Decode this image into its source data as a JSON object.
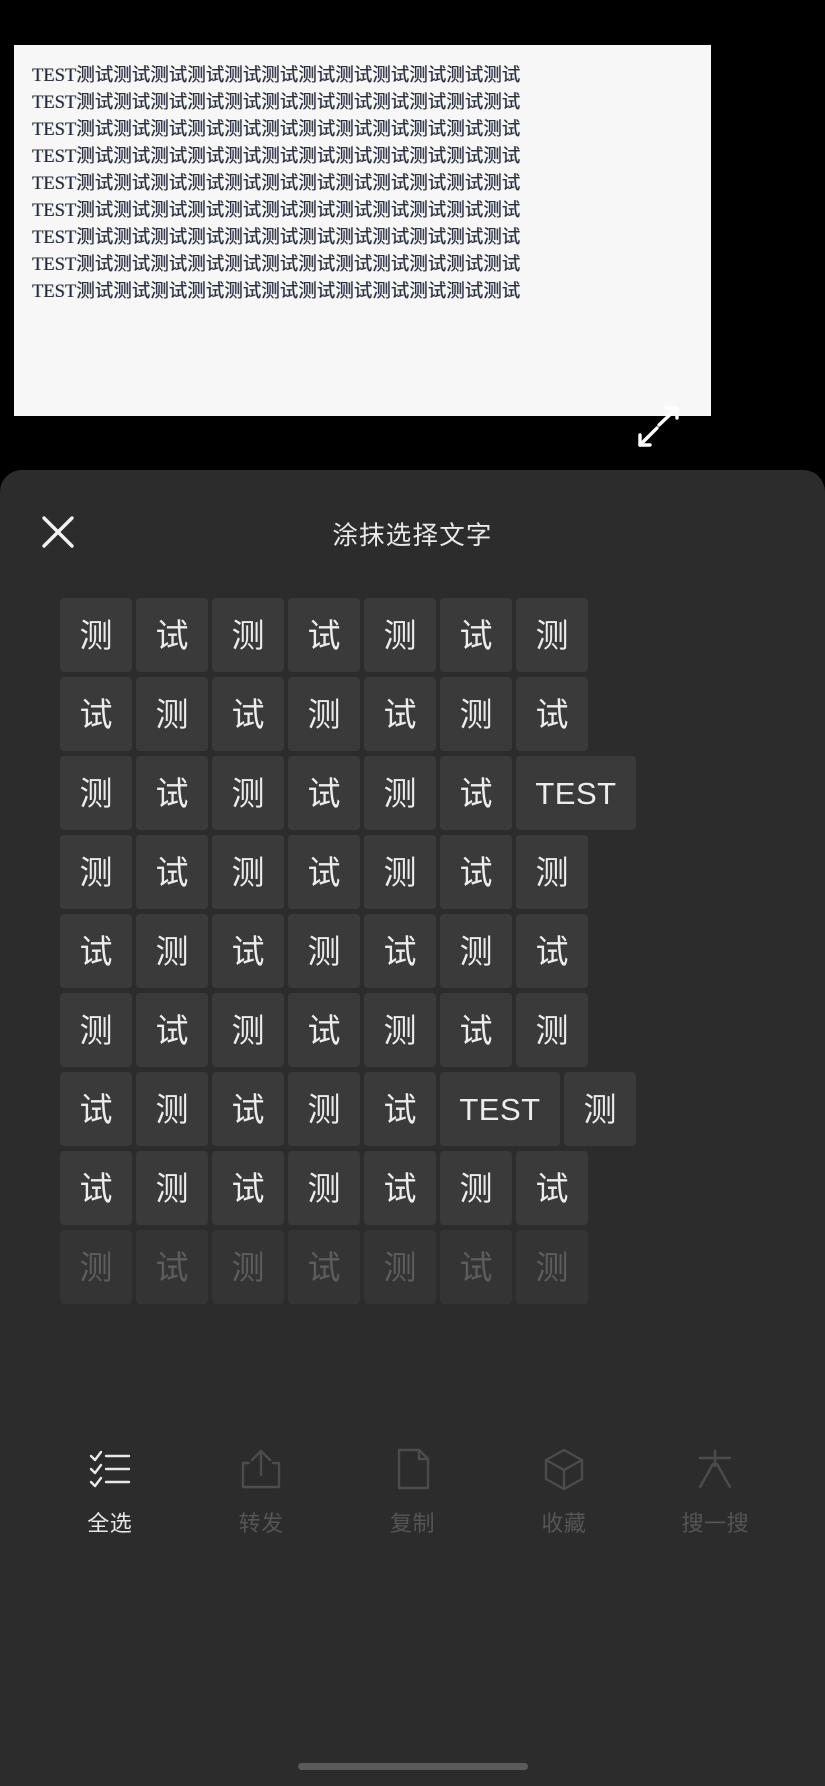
{
  "document": {
    "lines": [
      "TEST测试测试测试测试测试测试测试测试测试测试测试测试",
      "TEST测试测试测试测试测试测试测试测试测试测试测试测试",
      "TEST测试测试测试测试测试测试测试测试测试测试测试测试",
      "TEST测试测试测试测试测试测试测试测试测试测试测试测试",
      "TEST测试测试测试测试测试测试测试测试测试测试测试测试",
      "TEST测试测试测试测试测试测试测试测试测试测试测试测试",
      "TEST测试测试测试测试测试测试测试测试测试测试测试测试",
      "TEST测试测试测试测试测试测试测试测试测试测试测试测试",
      "TEST测试测试测试测试测试测试测试测试测试测试测试测试"
    ],
    "expand_icon": "expand-arrows-icon"
  },
  "sheet": {
    "title": "涂抹选择文字",
    "close_icon": "close-icon",
    "grid": {
      "rows": [
        {
          "faded": false,
          "cells": [
            "测",
            "试",
            "测",
            "试",
            "测",
            "试",
            "测"
          ]
        },
        {
          "faded": false,
          "cells": [
            "试",
            "测",
            "试",
            "测",
            "试",
            "测",
            "试"
          ]
        },
        {
          "faded": false,
          "cells": [
            "测",
            "试",
            "测",
            "试",
            "测",
            "试",
            "TEST"
          ]
        },
        {
          "faded": false,
          "cells": [
            "测",
            "试",
            "测",
            "试",
            "测",
            "试",
            "测"
          ]
        },
        {
          "faded": false,
          "cells": [
            "试",
            "测",
            "试",
            "测",
            "试",
            "测",
            "试"
          ]
        },
        {
          "faded": false,
          "cells": [
            "测",
            "试",
            "测",
            "试",
            "测",
            "试",
            "测"
          ]
        },
        {
          "faded": false,
          "cells": [
            "试",
            "测",
            "试",
            "测",
            "试",
            "TEST",
            "测"
          ]
        },
        {
          "faded": false,
          "cells": [
            "试",
            "测",
            "试",
            "测",
            "试",
            "测",
            "试"
          ]
        },
        {
          "faded": true,
          "cells": [
            "测",
            "试",
            "测",
            "试",
            "测",
            "试",
            "测"
          ]
        }
      ]
    },
    "toolbar": {
      "items": [
        {
          "label": "全选",
          "icon": "checklist-icon",
          "enabled": true
        },
        {
          "label": "转发",
          "icon": "share-icon",
          "enabled": false
        },
        {
          "label": "复制",
          "icon": "document-icon",
          "enabled": false
        },
        {
          "label": "收藏",
          "icon": "box-icon",
          "enabled": false
        },
        {
          "label": "搜一搜",
          "icon": "search-big-icon",
          "enabled": false
        }
      ]
    }
  },
  "colors": {
    "background": "#000000",
    "sheet": "#2c2c2c",
    "tile": "#3a3a3a",
    "tile_faded": "#343434",
    "text_primary": "#ececec",
    "text_disabled": "#555555",
    "document_bg": "#f7f7f7"
  }
}
